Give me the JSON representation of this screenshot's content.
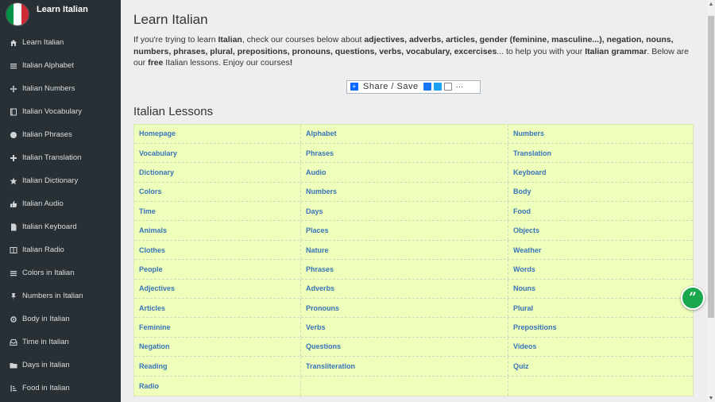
{
  "brand": {
    "title": "Learn Italian"
  },
  "colors": {
    "sidebar_bg": "#283035",
    "lessons_bg": "#eeffbb",
    "link": "#3a74b8",
    "quote_btn": "#1aa84f",
    "flag_green": "#009246",
    "flag_white": "#ffffff",
    "flag_red": "#ce2b37"
  },
  "sidebar": {
    "items": [
      {
        "label": "Learn Italian",
        "icon": "home-icon"
      },
      {
        "label": "Italian Alphabet",
        "icon": "list-icon"
      },
      {
        "label": "Italian Numbers",
        "icon": "move-icon"
      },
      {
        "label": "Italian Vocabulary",
        "icon": "book-icon"
      },
      {
        "label": "Italian Phrases",
        "icon": "globe-icon"
      },
      {
        "label": "Italian Translation",
        "icon": "plus-icon"
      },
      {
        "label": "Italian Dictionary",
        "icon": "star-icon"
      },
      {
        "label": "Italian Audio",
        "icon": "thumbs-up-icon"
      },
      {
        "label": "Italian Keyboard",
        "icon": "file-icon"
      },
      {
        "label": "Italian Radio",
        "icon": "columns-icon"
      },
      {
        "label": "Colors in Italian",
        "icon": "list-icon"
      },
      {
        "label": "Numbers in Italian",
        "icon": "pin-icon"
      },
      {
        "label": "Body in Italian",
        "icon": "gear-icon"
      },
      {
        "label": "Time in Italian",
        "icon": "inbox-icon"
      },
      {
        "label": "Days in Italian",
        "icon": "folder-icon"
      },
      {
        "label": "Food in Italian",
        "icon": "sort-icon"
      }
    ]
  },
  "main": {
    "title": "Learn Italian",
    "intro": {
      "p1": "If you're trying to learn ",
      "b1": "Italian",
      "p2": ", check our courses below about ",
      "b2": "adjectives, adverbs, articles, gender (feminine, masculine...), negation, nouns, numbers, phrases, plural, prepositions, pronouns, questions, verbs, vocabulary, excercises",
      "p3": "... to help you with your ",
      "b3": "Italian grammar",
      "p4": ". Below are our ",
      "b4": "free",
      "p5": " Italian lessons. Enjoy our courses",
      "b5": "!"
    },
    "share_label": "Share / Save",
    "lessons_title": "Italian Lessons",
    "lessons": [
      [
        "Homepage",
        "Alphabet",
        "Numbers"
      ],
      [
        "Vocabulary",
        "Phrases",
        "Translation"
      ],
      [
        "Dictionary",
        "Audio",
        "Keyboard"
      ],
      [
        "Colors",
        "Numbers",
        "Body"
      ],
      [
        "Time",
        "Days",
        "Food"
      ],
      [
        "Animals",
        "Places",
        "Objects"
      ],
      [
        "Clothes",
        "Nature",
        "Weather"
      ],
      [
        "People",
        "Phrases",
        "Words"
      ],
      [
        "Adjectives",
        "Adverbs",
        "Nouns"
      ],
      [
        "Articles",
        "Pronouns",
        "Plural"
      ],
      [
        "Feminine",
        "Verbs",
        "Prepositions"
      ],
      [
        "Negation",
        "Questions",
        "Videos"
      ],
      [
        "Reading",
        "Transliteration",
        "Quiz"
      ],
      [
        "Radio",
        "",
        ""
      ]
    ]
  }
}
